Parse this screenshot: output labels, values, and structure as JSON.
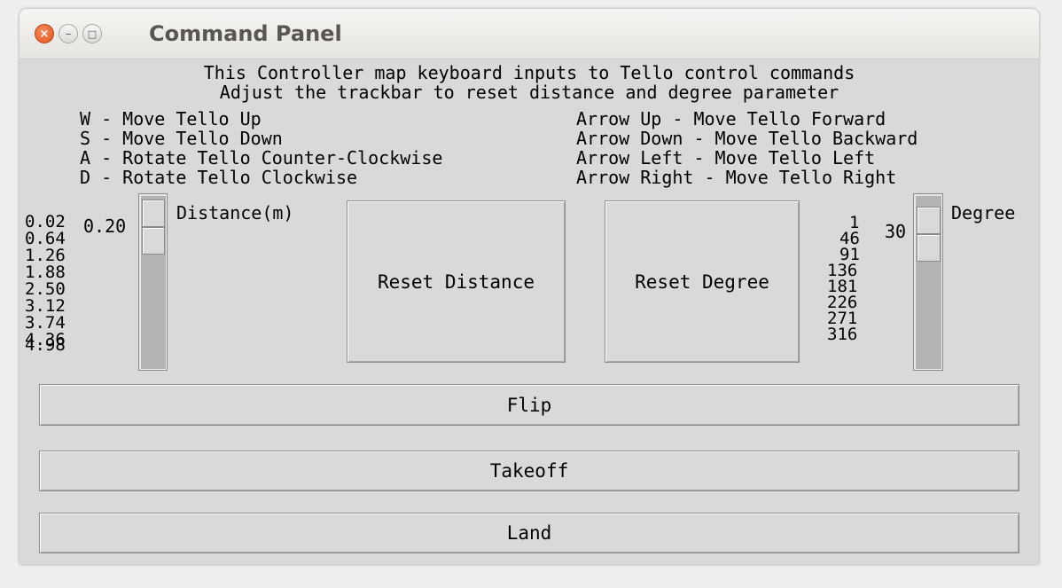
{
  "window": {
    "title": "Command Panel"
  },
  "header": {
    "line1": "This Controller map keyboard inputs to Tello control commands",
    "line2": "Adjust the trackbar to reset distance and degree parameter"
  },
  "keys_left": [
    "W - Move Tello Up",
    "S - Move Tello Down",
    "A - Rotate Tello Counter-Clockwise",
    "D - Rotate Tello Clockwise"
  ],
  "keys_right": [
    "Arrow Up - Move Tello Forward",
    "Arrow Down - Move Tello Backward",
    "Arrow Left - Move Tello Left",
    "Arrow Right - Move Tello Right"
  ],
  "distance_scale": {
    "label": "Distance(m)",
    "value": "0.20",
    "ticks": [
      "0.02",
      "0.64",
      "1.26",
      "1.88",
      "2.50",
      "3.12",
      "3.74",
      "4.36",
      "4.98"
    ]
  },
  "degree_scale": {
    "label": "Degree",
    "value": "30",
    "ticks": [
      "1",
      "46",
      "91",
      "136",
      "181",
      "226",
      "271",
      "316"
    ]
  },
  "buttons": {
    "reset_distance": "Reset Distance",
    "reset_degree": "Reset Degree",
    "flip": "Flip",
    "takeoff": "Takeoff",
    "land": "Land"
  }
}
